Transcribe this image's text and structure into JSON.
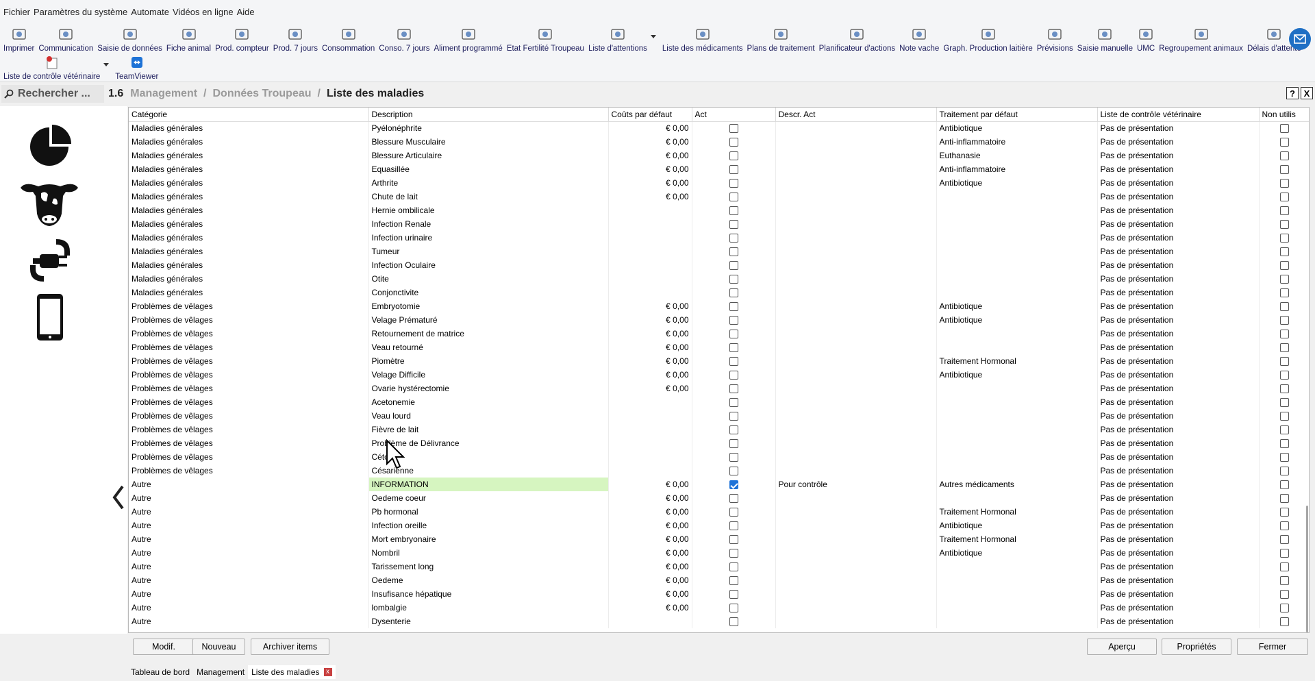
{
  "menubar": [
    "Fichier",
    "Paramètres du système",
    "Automate",
    "Vidéos en ligne",
    "Aide"
  ],
  "toolbar": [
    {
      "label": "Imprimer",
      "icon": "printer-icon"
    },
    {
      "label": "Communication",
      "icon": "antenna-icon"
    },
    {
      "label": "Saisie de données",
      "icon": "calendar-icon"
    },
    {
      "label": "Fiche animal",
      "icon": "cow-icon"
    },
    {
      "label": "Prod. compteur",
      "icon": "milk-meter-icon"
    },
    {
      "label": "Prod. 7 jours",
      "icon": "milk-bottle-icon"
    },
    {
      "label": "Consommation",
      "icon": "cow-feed-icon"
    },
    {
      "label": "Conso. 7 jours",
      "icon": "cow-feed-7-icon"
    },
    {
      "label": "Aliment programmé",
      "icon": "grain-icon"
    },
    {
      "label": "Etat Fertilité Troupeau",
      "icon": "syringe-icon"
    },
    {
      "label": "Liste d'attentions",
      "icon": "list-icon"
    },
    {
      "label": "Liste des médicaments",
      "icon": "medicine-icon"
    },
    {
      "label": "Plans de traitement",
      "icon": "treatment-icon"
    },
    {
      "label": "Planificateur d'actions",
      "icon": "clock-icon"
    },
    {
      "label": "Note vache",
      "icon": "apple-icon"
    },
    {
      "label": "Graph. Production laitière",
      "icon": "graph-icon"
    },
    {
      "label": "Prévisions",
      "icon": "forecast-icon"
    },
    {
      "label": "Saisie manuelle",
      "icon": "bucket-icon"
    },
    {
      "label": "UMC",
      "icon": "umc-icon"
    },
    {
      "label": "Regroupement animaux",
      "icon": "herd-icon"
    },
    {
      "label": "Délais d'attente",
      "icon": "timer-icon"
    }
  ],
  "toolbar2": [
    {
      "label": "Liste de contrôle vétérinaire",
      "icon": "vet-checklist-icon"
    },
    {
      "label": "TeamViewer",
      "icon": "teamviewer-icon"
    }
  ],
  "nav": {
    "search": "Rechercher ...",
    "number": "1.6",
    "crumb1": "Management",
    "crumb2": "Données Troupeau",
    "current": "Liste des maladies",
    "help": "?",
    "close": "X"
  },
  "columns": [
    "Catégorie",
    "Description",
    "Coûts par défaut",
    "Act",
    "Descr. Act",
    "Traitement par défaut",
    "Liste de contrôle vétérinaire",
    "Non utilis"
  ],
  "rows": [
    {
      "cat": "Maladies générales",
      "desc": "Pyélonéphrite",
      "cost": "€ 0,00",
      "act": false,
      "descr": "",
      "trait": "Antibiotique",
      "vet": "Pas de présentation",
      "non": false
    },
    {
      "cat": "Maladies générales",
      "desc": "Blessure Musculaire",
      "cost": "€ 0,00",
      "act": false,
      "descr": "",
      "trait": "Anti-inflammatoire",
      "vet": "Pas de présentation",
      "non": false
    },
    {
      "cat": "Maladies générales",
      "desc": "Blessure Articulaire",
      "cost": "€ 0,00",
      "act": false,
      "descr": "",
      "trait": "Euthanasie",
      "vet": "Pas de présentation",
      "non": false
    },
    {
      "cat": "Maladies générales",
      "desc": "Equasillée",
      "cost": "€ 0,00",
      "act": false,
      "descr": "",
      "trait": "Anti-inflammatoire",
      "vet": "Pas de présentation",
      "non": false
    },
    {
      "cat": "Maladies générales",
      "desc": "Arthrite",
      "cost": "€ 0,00",
      "act": false,
      "descr": "",
      "trait": "Antibiotique",
      "vet": "Pas de présentation",
      "non": false
    },
    {
      "cat": "Maladies générales",
      "desc": "Chute de lait",
      "cost": "€ 0,00",
      "act": false,
      "descr": "",
      "trait": "",
      "vet": "Pas de présentation",
      "non": false
    },
    {
      "cat": "Maladies générales",
      "desc": "Hernie ombilicale",
      "cost": "",
      "act": false,
      "descr": "",
      "trait": "",
      "vet": "Pas de présentation",
      "non": false
    },
    {
      "cat": "Maladies générales",
      "desc": "Infection Renale",
      "cost": "",
      "act": false,
      "descr": "",
      "trait": "",
      "vet": "Pas de présentation",
      "non": false
    },
    {
      "cat": "Maladies générales",
      "desc": "Infection urinaire",
      "cost": "",
      "act": false,
      "descr": "",
      "trait": "",
      "vet": "Pas de présentation",
      "non": false
    },
    {
      "cat": "Maladies générales",
      "desc": "Tumeur",
      "cost": "",
      "act": false,
      "descr": "",
      "trait": "",
      "vet": "Pas de présentation",
      "non": false
    },
    {
      "cat": "Maladies générales",
      "desc": "Infection Oculaire",
      "cost": "",
      "act": false,
      "descr": "",
      "trait": "",
      "vet": "Pas de présentation",
      "non": false
    },
    {
      "cat": "Maladies générales",
      "desc": "Otite",
      "cost": "",
      "act": false,
      "descr": "",
      "trait": "",
      "vet": "Pas de présentation",
      "non": false
    },
    {
      "cat": "Maladies générales",
      "desc": "Conjonctivite",
      "cost": "",
      "act": false,
      "descr": "",
      "trait": "",
      "vet": "Pas de présentation",
      "non": false
    },
    {
      "cat": "Problèmes de vêlages",
      "desc": "Embryotomie",
      "cost": "€ 0,00",
      "act": false,
      "descr": "",
      "trait": "Antibiotique",
      "vet": "Pas de présentation",
      "non": false
    },
    {
      "cat": "Problèmes de vêlages",
      "desc": "Velage Prématuré",
      "cost": "€ 0,00",
      "act": false,
      "descr": "",
      "trait": "Antibiotique",
      "vet": "Pas de présentation",
      "non": false
    },
    {
      "cat": "Problèmes de vêlages",
      "desc": "Retournement de matrice",
      "cost": "€ 0,00",
      "act": false,
      "descr": "",
      "trait": "",
      "vet": "Pas de présentation",
      "non": false
    },
    {
      "cat": "Problèmes de vêlages",
      "desc": "Veau retourné",
      "cost": "€ 0,00",
      "act": false,
      "descr": "",
      "trait": "",
      "vet": "Pas de présentation",
      "non": false
    },
    {
      "cat": "Problèmes de vêlages",
      "desc": "Piomètre",
      "cost": "€ 0,00",
      "act": false,
      "descr": "",
      "trait": "Traitement Hormonal",
      "vet": "Pas de présentation",
      "non": false
    },
    {
      "cat": "Problèmes de vêlages",
      "desc": "Velage Difficile",
      "cost": "€ 0,00",
      "act": false,
      "descr": "",
      "trait": "Antibiotique",
      "vet": "Pas de présentation",
      "non": false
    },
    {
      "cat": "Problèmes de vêlages",
      "desc": "Ovarie hystérectomie",
      "cost": "€ 0,00",
      "act": false,
      "descr": "",
      "trait": "",
      "vet": "Pas de présentation",
      "non": false
    },
    {
      "cat": "Problèmes de vêlages",
      "desc": "Acetonemie",
      "cost": "",
      "act": false,
      "descr": "",
      "trait": "",
      "vet": "Pas de présentation",
      "non": false
    },
    {
      "cat": "Problèmes de vêlages",
      "desc": "Veau lourd",
      "cost": "",
      "act": false,
      "descr": "",
      "trait": "",
      "vet": "Pas de présentation",
      "non": false
    },
    {
      "cat": "Problèmes de vêlages",
      "desc": "Fièvre de lait",
      "cost": "",
      "act": false,
      "descr": "",
      "trait": "",
      "vet": "Pas de présentation",
      "non": false
    },
    {
      "cat": "Problèmes de vêlages",
      "desc": "Problème de Délivrance",
      "cost": "",
      "act": false,
      "descr": "",
      "trait": "",
      "vet": "Pas de présentation",
      "non": false
    },
    {
      "cat": "Problèmes de vêlages",
      "desc": "Céto",
      "cost": "",
      "act": false,
      "descr": "",
      "trait": "",
      "vet": "Pas de présentation",
      "non": false
    },
    {
      "cat": "Problèmes de vêlages",
      "desc": "Césarienne",
      "cost": "",
      "act": false,
      "descr": "",
      "trait": "",
      "vet": "Pas de présentation",
      "non": false
    },
    {
      "cat": "Autre",
      "desc": "INFORMATION",
      "cost": "€ 0,00",
      "act": true,
      "descr": "Pour contrôle",
      "trait": "Autres médicaments",
      "vet": "Pas de présentation",
      "non": false,
      "highlight": true
    },
    {
      "cat": "Autre",
      "desc": "Oedeme coeur",
      "cost": "€ 0,00",
      "act": false,
      "descr": "",
      "trait": "",
      "vet": "Pas de présentation",
      "non": false
    },
    {
      "cat": "Autre",
      "desc": "Pb hormonal",
      "cost": "€ 0,00",
      "act": false,
      "descr": "",
      "trait": "Traitement Hormonal",
      "vet": "Pas de présentation",
      "non": false
    },
    {
      "cat": "Autre",
      "desc": "Infection oreille",
      "cost": "€ 0,00",
      "act": false,
      "descr": "",
      "trait": "Antibiotique",
      "vet": "Pas de présentation",
      "non": false
    },
    {
      "cat": "Autre",
      "desc": "Mort embryonaire",
      "cost": "€ 0,00",
      "act": false,
      "descr": "",
      "trait": "Traitement Hormonal",
      "vet": "Pas de présentation",
      "non": false
    },
    {
      "cat": "Autre",
      "desc": "Nombril",
      "cost": "€ 0,00",
      "act": false,
      "descr": "",
      "trait": "Antibiotique",
      "vet": "Pas de présentation",
      "non": false
    },
    {
      "cat": "Autre",
      "desc": "Tarissement long",
      "cost": "€ 0,00",
      "act": false,
      "descr": "",
      "trait": "",
      "vet": "Pas de présentation",
      "non": false
    },
    {
      "cat": "Autre",
      "desc": "Oedeme",
      "cost": "€ 0,00",
      "act": false,
      "descr": "",
      "trait": "",
      "vet": "Pas de présentation",
      "non": false
    },
    {
      "cat": "Autre",
      "desc": "Insufisance hépatique",
      "cost": "€ 0,00",
      "act": false,
      "descr": "",
      "trait": "",
      "vet": "Pas de présentation",
      "non": false
    },
    {
      "cat": "Autre",
      "desc": "lombalgie",
      "cost": "€ 0,00",
      "act": false,
      "descr": "",
      "trait": "",
      "vet": "Pas de présentation",
      "non": false
    },
    {
      "cat": "Autre",
      "desc": "Dysenterie",
      "cost": "",
      "act": false,
      "descr": "",
      "trait": "",
      "vet": "Pas de présentation",
      "non": false
    }
  ],
  "buttons": {
    "modif": "Modif.",
    "nouveau": "Nouveau",
    "archiver": "Archiver items",
    "apercu": "Aperçu",
    "proprietes": "Propriétés",
    "fermer": "Fermer"
  },
  "tabs": [
    "Tableau de bord",
    "Management",
    "Liste des maladies"
  ],
  "colors": {
    "highlight": "#d6f5c0",
    "checkbox_checked": "#1e73d8",
    "breadcrumb_inactive": "#9a9a9a",
    "tab_close": "#c84040"
  }
}
